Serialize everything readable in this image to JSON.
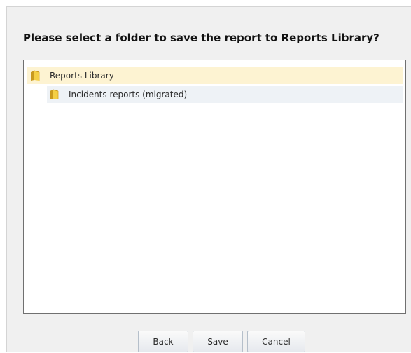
{
  "dialog": {
    "prompt": "Please select a folder to save the report to Reports Library?"
  },
  "tree": {
    "root": {
      "label": "Reports Library",
      "icon": "folder-icon",
      "highlight_color": "#fdf3d2"
    },
    "children": [
      {
        "label": "Incidents reports (migrated)",
        "icon": "folder-icon",
        "highlight_color": "#eef2f6"
      }
    ]
  },
  "buttons": {
    "back": "Back",
    "save": "Save",
    "cancel": "Cancel"
  }
}
